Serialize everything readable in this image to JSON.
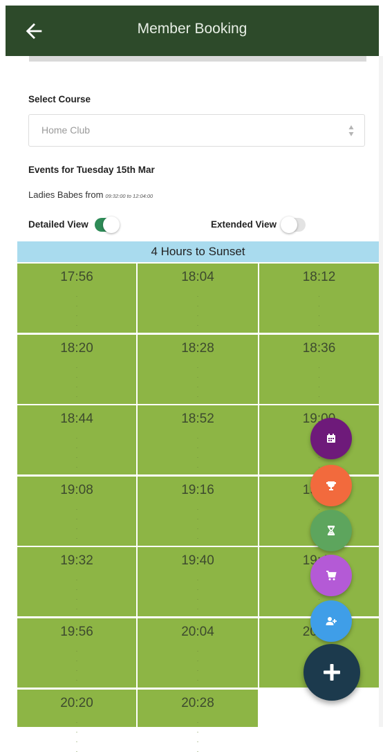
{
  "header": {
    "title": "Member Booking"
  },
  "course": {
    "label": "Select Course",
    "value": "Home Club"
  },
  "events": {
    "heading": "Events for Tuesday 15th Mar",
    "name": "Ladies Babes from",
    "time_range": "09:32:00 to 12:04:00"
  },
  "views": {
    "detailed": {
      "label": "Detailed View",
      "on": true
    },
    "extended": {
      "label": "Extended View",
      "on": false
    }
  },
  "sunset": {
    "text": "4 Hours to Sunset"
  },
  "tee_times": [
    "17:56",
    "18:04",
    "18:12",
    "18:20",
    "18:28",
    "18:36",
    "18:44",
    "18:52",
    "19:00",
    "19:08",
    "19:16",
    "19:24",
    "19:32",
    "19:40",
    "19:48",
    "19:56",
    "20:04",
    "20:12",
    "20:20",
    "20:28"
  ],
  "colors": {
    "header_bg": "#2d4a2a",
    "slot_green": "#8db545",
    "sunset_bar": "#a9dbee",
    "toggle_on": "#2e8b57",
    "fab_main": "#1c3a4d",
    "fab_calendar": "#6e1a7a",
    "fab_trophy": "#f26a3d",
    "fab_hourglass": "#5da55d",
    "fab_cart": "#b45ad6",
    "fab_add_user": "#3f9ee8"
  },
  "fab_icons": [
    "calendar-icon",
    "trophy-icon",
    "hourglass-icon",
    "cart-icon",
    "add-user-icon",
    "plus-icon"
  ]
}
